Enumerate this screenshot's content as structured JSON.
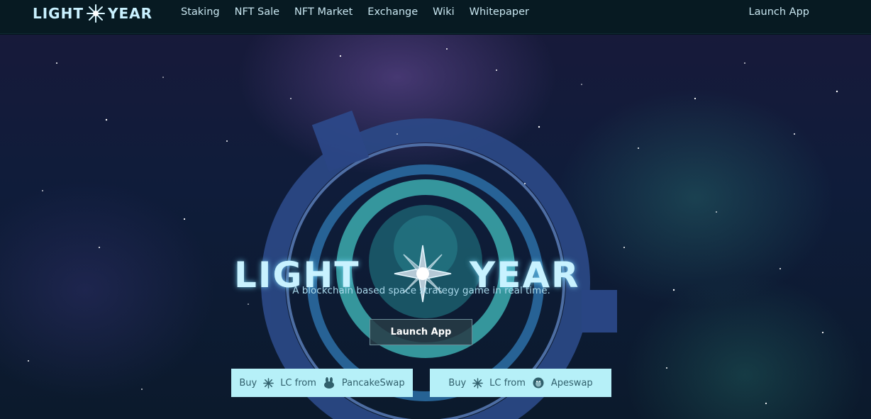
{
  "nav": {
    "logo_left": "LIGHT",
    "logo_right": "YEAR",
    "links": [
      "Staking",
      "NFT Sale",
      "NFT Market",
      "Exchange",
      "Wiki",
      "Whitepaper"
    ],
    "launch": "Launch App"
  },
  "hero": {
    "logo_left": "LIGHT",
    "logo_right": "YEAR",
    "tagline": "A blockchain based space strategy game in real time.",
    "launch_button": "Launch App",
    "buy_buttons": [
      {
        "buy": "Buy",
        "from": "LC from",
        "exchange": "PancakeSwap",
        "token_icon": "star-icon",
        "exchange_icon": "pancakeswap-bunny-icon"
      },
      {
        "buy": "Buy",
        "from": "LC from",
        "exchange": "Apeswap",
        "token_icon": "star-icon",
        "exchange_icon": "apeswap-monkey-icon"
      }
    ]
  },
  "colors": {
    "nav_bg": "#071a22",
    "logo_text": "#c8f2ff",
    "buy_button_bg": "#b6f0f8",
    "buy_button_text": "#31606c"
  }
}
